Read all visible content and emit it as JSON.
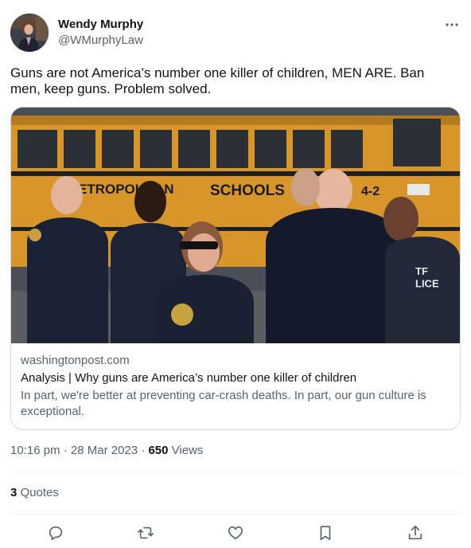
{
  "author": {
    "display_name": "Wendy Murphy",
    "handle": "@WMurphyLaw"
  },
  "icons": {
    "more": "more-horizontal-icon",
    "reply": "reply-icon",
    "retweet": "retweet-icon",
    "like": "heart-icon",
    "bookmark": "bookmark-icon",
    "share": "share-icon"
  },
  "tweet": {
    "text": "Guns are not America’s number one killer of children, MEN ARE. Ban men, keep guns. Problem solved."
  },
  "link_card": {
    "domain": "washingtonpost.com",
    "title": "Analysis | Why guns are America’s number one killer of children",
    "description": "In part, we're better at preventing car-crash deaths. In part, our gun culture is exceptional.",
    "image_text": {
      "bus_left": "ETROPOLITAN",
      "bus_right": "SCHOOLS",
      "bus_number": "4-2",
      "vest_text": "TF\nLICE"
    }
  },
  "meta": {
    "time": "10:16 pm",
    "sep1": "·",
    "date": "28 Mar 2023",
    "sep2": "·",
    "views_count": "650",
    "views_label": "Views"
  },
  "engagement": {
    "quotes_count": "3",
    "quotes_label": "Quotes"
  },
  "colors": {
    "text_primary": "#0f1419",
    "text_secondary": "#536471",
    "border": "#cfd9de",
    "divider": "#eff3f4"
  }
}
